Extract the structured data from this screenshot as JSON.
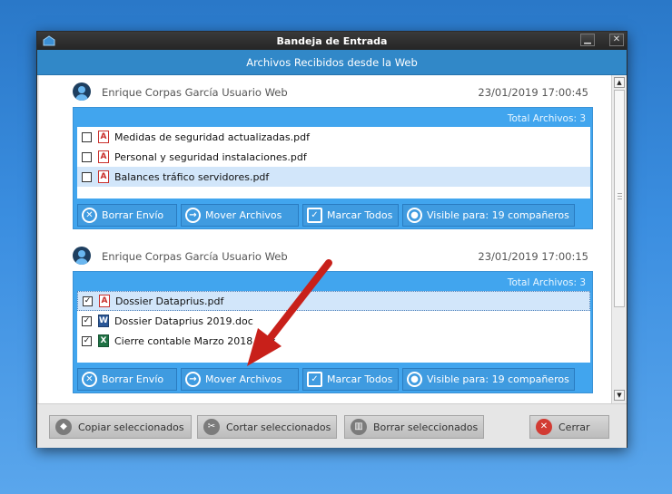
{
  "window": {
    "title": "Bandeja de Entrada",
    "minimize_glyph": "▁",
    "close_glyph": "✕"
  },
  "subheader": "Archivos Recibidos desde la Web",
  "entries": [
    {
      "sender": "Enrique Corpas García Usuario Web",
      "date": "23/01/2019 17:00:45",
      "total": "Total Archivos: 3",
      "files": [
        {
          "name": "Medidas de seguridad actualizadas.pdf",
          "type": "pdf",
          "checked": false
        },
        {
          "name": "Personal y seguridad instalaciones.pdf",
          "type": "pdf",
          "checked": false
        },
        {
          "name": "Balances tráfico servidores.pdf",
          "type": "pdf",
          "checked": false
        }
      ],
      "actions": {
        "delete": "Borrar Envío",
        "move": "Mover Archivos",
        "mark_all": "Marcar Todos",
        "visible": "Visible para: 19 compañeros"
      }
    },
    {
      "sender": "Enrique Corpas García Usuario Web",
      "date": "23/01/2019 17:00:15",
      "total": "Total Archivos: 3",
      "files": [
        {
          "name": "Dossier Dataprius.pdf",
          "type": "pdf",
          "checked": true
        },
        {
          "name": "Dossier Dataprius 2019.doc",
          "type": "doc",
          "checked": true
        },
        {
          "name": "Cierre contable Marzo 2018.xlsx",
          "type": "xls",
          "checked": true
        }
      ],
      "actions": {
        "delete": "Borrar Envío",
        "move": "Mover Archivos",
        "mark_all": "Marcar Todos",
        "visible": "Visible para: 19 compañeros"
      }
    }
  ],
  "footer": {
    "copy": "Copiar seleccionados",
    "cut": "Cortar seleccionados",
    "delete": "Borrar seleccionados",
    "close": "Cerrar"
  },
  "glyphs": {
    "check": "✓",
    "pdf": "A",
    "doc": "W",
    "xls": "X",
    "delete": "✕",
    "move": "→",
    "mark": "✓",
    "person": "●",
    "scroll_up": "▲",
    "scroll_down": "▼",
    "copy": "◆",
    "cut": "✂",
    "trash": "▥",
    "close": "✕"
  },
  "colors": {
    "panel": "#41a5ee",
    "header": "#3188c8",
    "annotation_arrow": "#c8201a"
  }
}
